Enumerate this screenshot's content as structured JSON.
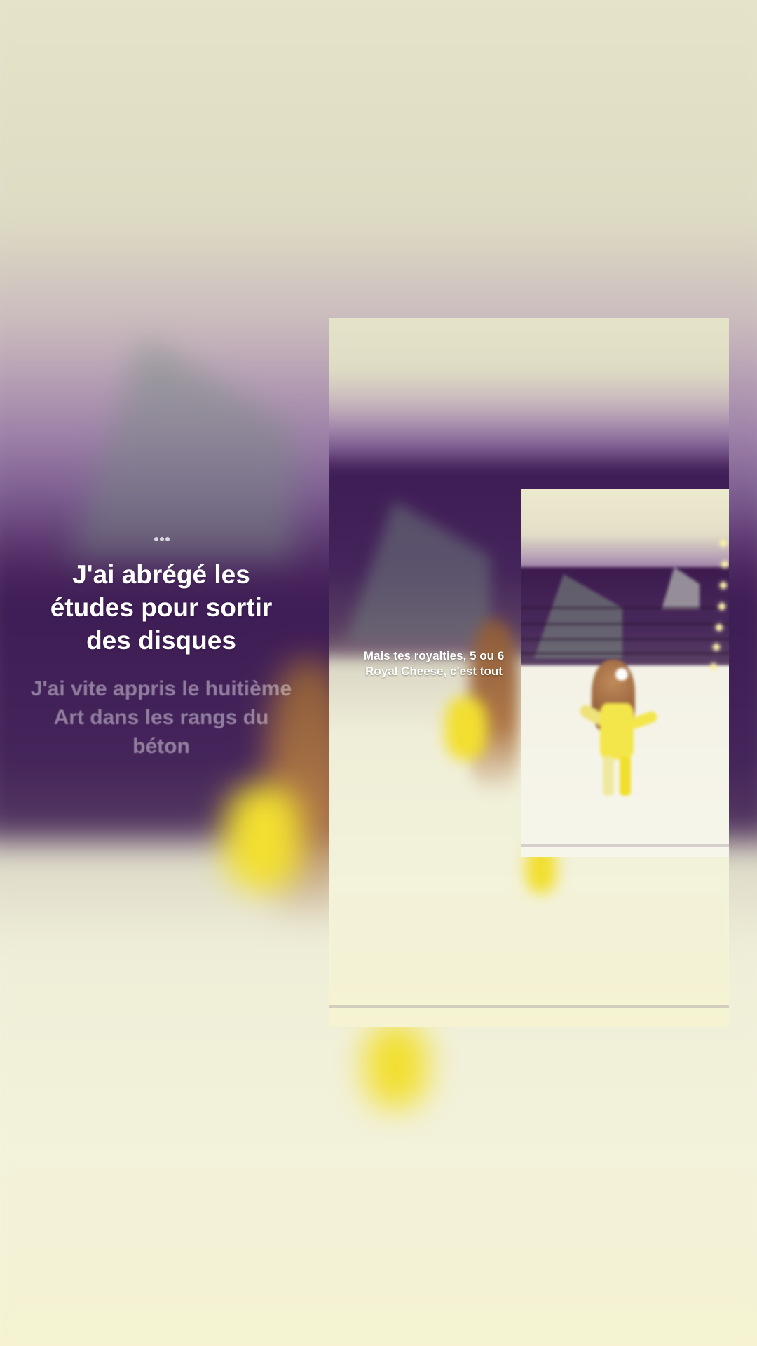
{
  "story": {
    "typing_indicator": "•••",
    "caption_main": "J'ai abrégé les études pour sortir des disques",
    "caption_next": "J'ai vite appris le huitième Art dans les rangs du béton",
    "caption_overlay": "Mais tes royalties, 5 ou 6 Royal Cheese, c'est tout"
  },
  "colors": {
    "sky": "#e6e4c8",
    "wall": "#3e1c55",
    "floor": "#f3f2da",
    "outfit_yellow": "#f2df30",
    "caption_text": "#ffffff"
  }
}
